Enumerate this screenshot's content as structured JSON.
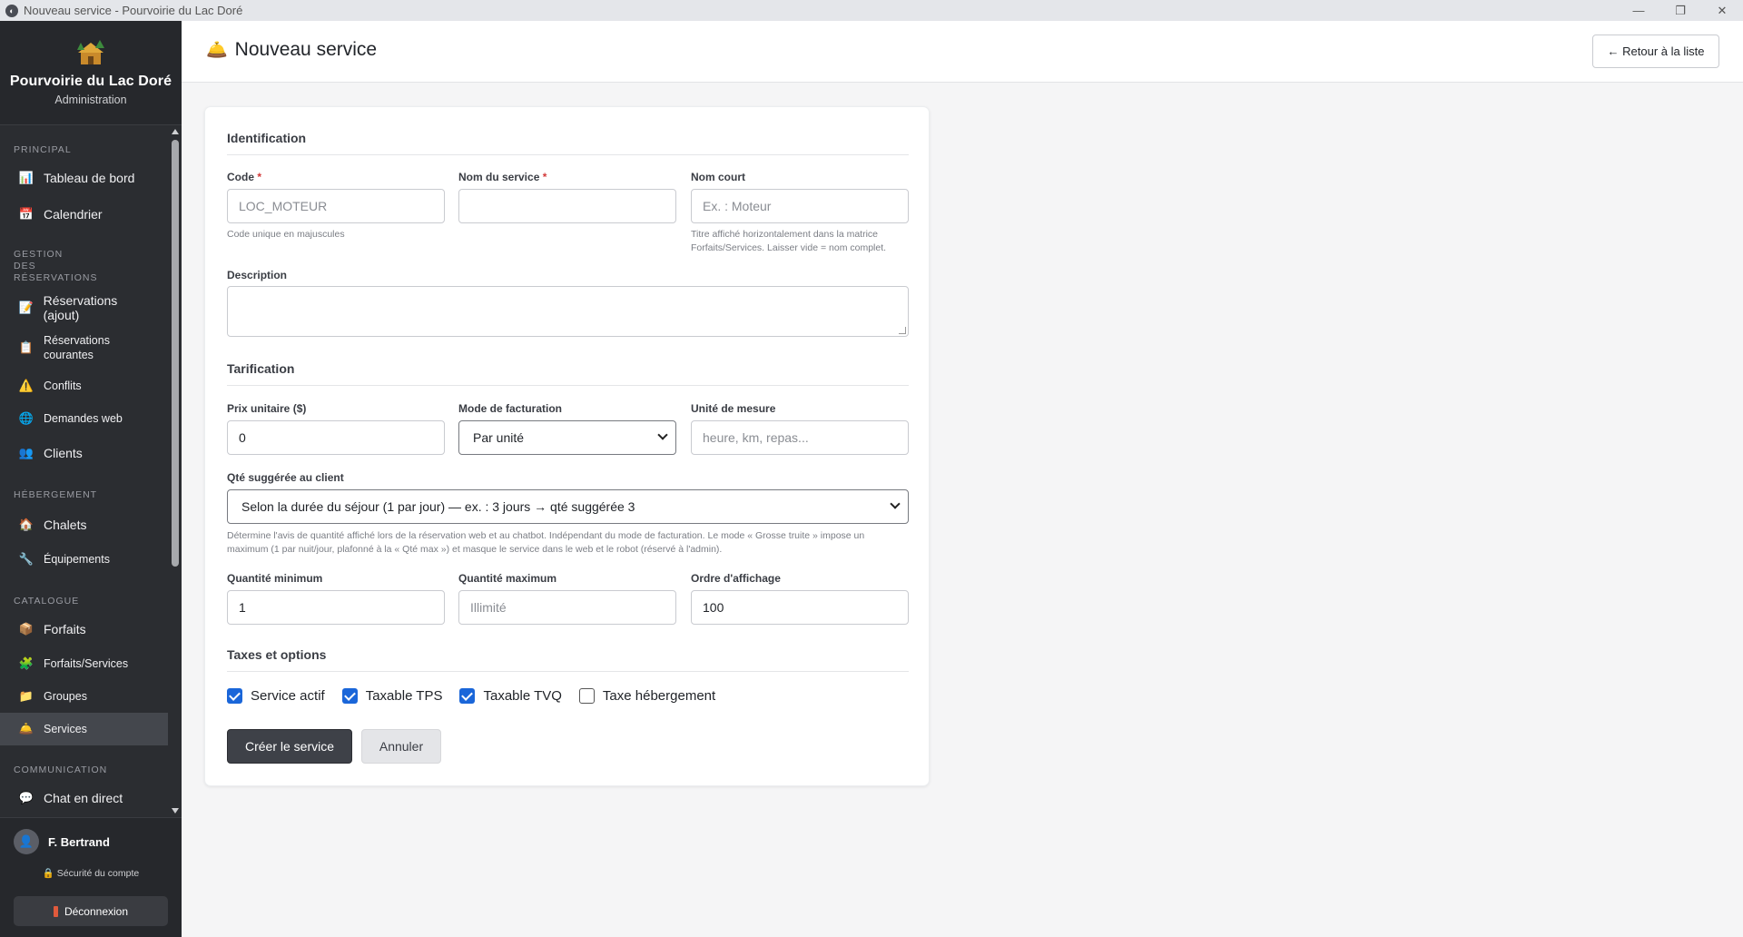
{
  "window": {
    "title": "Nouveau service - Pourvoirie du Lac Doré",
    "minimize": "—",
    "maximize": "❐",
    "close": "✕"
  },
  "brand": {
    "name": "Pourvoirie du Lac Doré",
    "subtitle": "Administration"
  },
  "sidebar": {
    "sections": {
      "principal": "PRINCIPAL",
      "reservations": "GESTION DES RÉSERVATIONS",
      "hebergement": "HÉBERGEMENT",
      "catalogue": "CATALOGUE",
      "communication": "COMMUNICATION"
    },
    "items": {
      "dashboard": "Tableau de bord",
      "calendar": "Calendrier",
      "reservations_add": "Réservations (ajout)",
      "reservations_current": "Réservations courantes",
      "conflicts": "Conflits",
      "web_requests": "Demandes web",
      "clients": "Clients",
      "chalets": "Chalets",
      "equipment": "Équipements",
      "packages": "Forfaits",
      "packages_services": "Forfaits/Services",
      "groups": "Groupes",
      "services": "Services",
      "live_chat": "Chat en direct"
    },
    "user": {
      "name": "F. Bertrand",
      "security": "Sécurité du compte",
      "logout": "Déconnexion"
    }
  },
  "header": {
    "title": "Nouveau service",
    "back_button": "← Retour à la liste"
  },
  "form": {
    "identification": {
      "title": "Identification",
      "code_label": "Code",
      "code_placeholder": "LOC_MOTEUR",
      "code_help": "Code unique en majuscules",
      "name_label": "Nom du service",
      "name_value": "",
      "short_label": "Nom court",
      "short_placeholder": "Ex. : Moteur",
      "short_help_1": "Titre affiché horizontalement dans la matrice",
      "short_help_2": "Forfaits/Services. Laisser vide = nom complet.",
      "description_label": "Description",
      "required_mark": "*"
    },
    "pricing": {
      "title": "Tarification",
      "unit_price_label": "Prix unitaire ($)",
      "unit_price_value": "0",
      "billing_mode_label": "Mode de facturation",
      "billing_mode_value": "Par unité",
      "unit_label": "Unité de mesure",
      "unit_placeholder": "heure, km, repas...",
      "suggested_qty_label": "Qté suggérée au client",
      "suggested_qty_value": "Selon la durée du séjour (1 par jour) — ex. : 3 jours → qté suggérée 3",
      "suggested_help_1": "Détermine l'avis de quantité affiché lors de la réservation web et au chatbot. Indépendant du mode de facturation. Le mode « Grosse truite » impose un",
      "suggested_help_2": "maximum (1 par nuit/jour, plafonné à la « Qté max ») et masque le service dans le web et le robot (réservé à l'admin).",
      "min_qty_label": "Quantité minimum",
      "min_qty_value": "1",
      "max_qty_label": "Quantité maximum",
      "max_qty_placeholder": "Illimité",
      "display_order_label": "Ordre d'affichage",
      "display_order_value": "100"
    },
    "taxes": {
      "title": "Taxes et options",
      "active": "Service actif",
      "tps": "Taxable TPS",
      "tvq": "Taxable TVQ",
      "lodging": "Taxe hébergement"
    },
    "submit": "Créer le service",
    "cancel": "Annuler"
  },
  "colors": {
    "sidebar_bg": "#2b2d31",
    "primary_button": "#3e4148",
    "checkbox_checked": "#1a66d9",
    "required": "#d33a3a"
  }
}
